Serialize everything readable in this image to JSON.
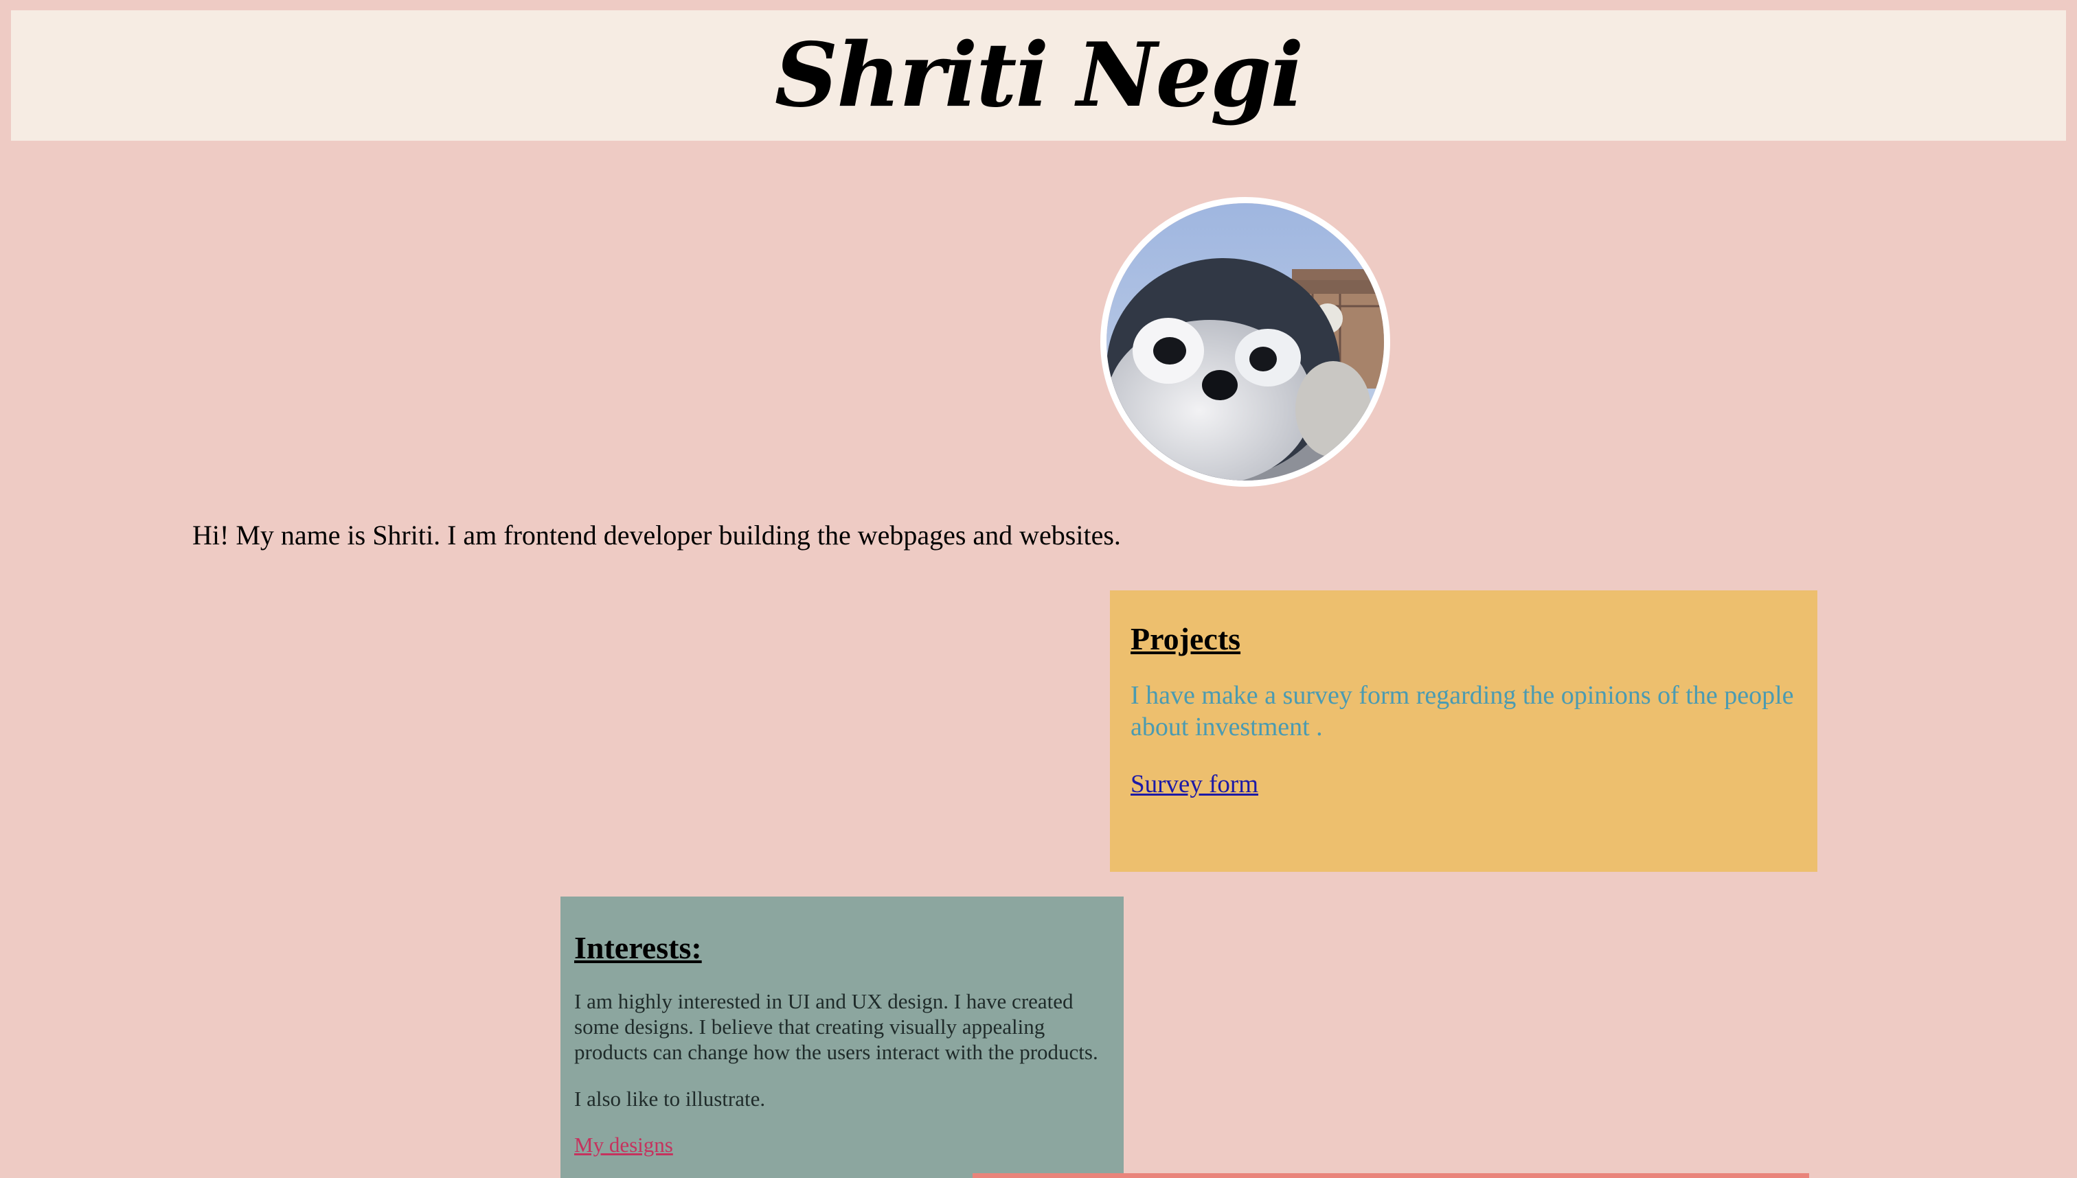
{
  "header": {
    "name": "Shriti Negi"
  },
  "intro": {
    "text": "Hi! My name is Shriti. I am frontend developer building the webpages and websites."
  },
  "projects": {
    "heading": "Projects",
    "description": "I have make a survey form regarding the opinions of the people about investment .",
    "link_label": "Survey form"
  },
  "interests": {
    "heading": "Interests:",
    "paragraph_1": "I am highly interested in UI and UX design. I have created some designs. I believe that creating visually appealing products can change how the users interact with the products.",
    "paragraph_2": "I also like to illustrate.",
    "link_label": "My designs"
  },
  "colors": {
    "page_background": "#eecbc4",
    "header_background": "#f6ece3",
    "projects_background": "#edbf6e",
    "projects_text": "#4a9bb2",
    "interests_background": "#8ca69f",
    "interests_link": "#c5335e",
    "projects_link": "#1d1aa6"
  },
  "images": {
    "avatar": "penguin-chick-photo"
  }
}
